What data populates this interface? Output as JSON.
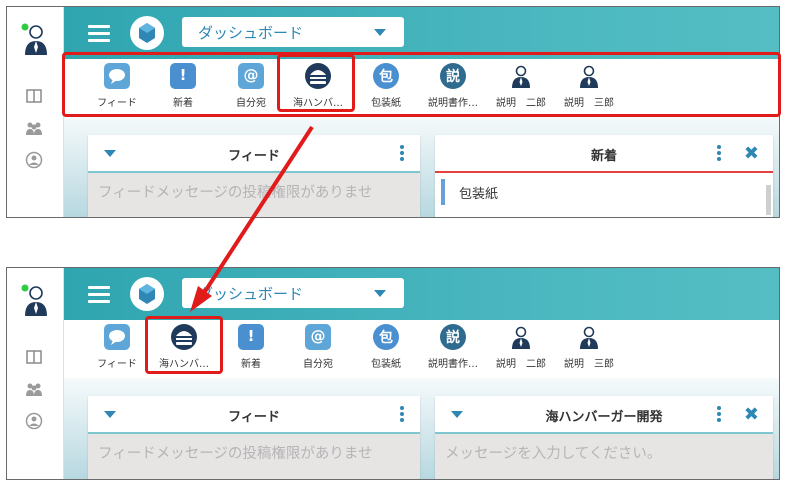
{
  "colors": {
    "header": "#3aaeb8",
    "accent": "#2e87b5",
    "highlight": "#e11a1a",
    "status_online": "#2ecc40"
  },
  "top": {
    "dropdown": {
      "label": "ダッシュボード"
    },
    "toolbar": [
      {
        "label": "フィード",
        "icon": "chat-icon"
      },
      {
        "label": "新着",
        "icon": "exclamation-icon"
      },
      {
        "label": "自分宛",
        "icon": "at-icon"
      },
      {
        "label": "海ハンバ…",
        "icon": "hamburger-icon"
      },
      {
        "label": "包装紙",
        "icon": "kanji-bao-icon",
        "glyph": "包"
      },
      {
        "label": "説明書作…",
        "icon": "kanji-setsu-icon",
        "glyph": "説"
      },
      {
        "label": "説明　二郎",
        "icon": "user-suit-icon"
      },
      {
        "label": "説明　三郎",
        "icon": "user-suit-icon"
      }
    ],
    "cards": {
      "feed": {
        "title": "フィード",
        "placeholder": "フィードメッセージの投稿権限がありませ"
      },
      "news": {
        "title": "新着",
        "item": "包装紙"
      }
    }
  },
  "bottom": {
    "dropdown": {
      "label": "ダッシュボード"
    },
    "toolbar": [
      {
        "label": "フィード",
        "icon": "chat-icon"
      },
      {
        "label": "海ハンバ…",
        "icon": "hamburger-icon"
      },
      {
        "label": "新着",
        "icon": "exclamation-icon"
      },
      {
        "label": "自分宛",
        "icon": "at-icon"
      },
      {
        "label": "包装紙",
        "icon": "kanji-bao-icon",
        "glyph": "包"
      },
      {
        "label": "説明書作…",
        "icon": "kanji-setsu-icon",
        "glyph": "説"
      },
      {
        "label": "説明　二郎",
        "icon": "user-suit-icon"
      },
      {
        "label": "説明　三郎",
        "icon": "user-suit-icon"
      }
    ],
    "cards": {
      "feed": {
        "title": "フィード",
        "placeholder": "フィードメッセージの投稿権限がありませ"
      },
      "hamburger": {
        "title": "海ハンバーガー開発",
        "placeholder": "メッセージを入力してください。"
      }
    }
  }
}
